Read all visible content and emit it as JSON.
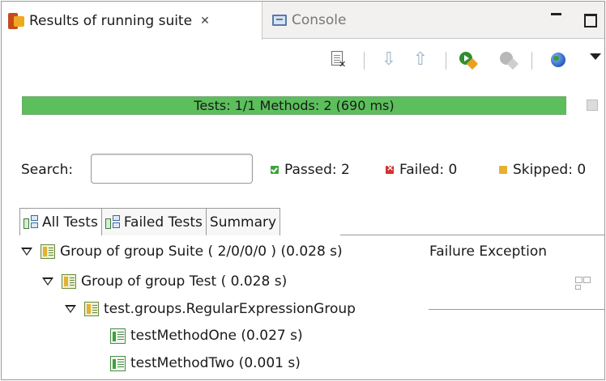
{
  "tabs": {
    "results_label": "Results of running suite",
    "console_label": "Console"
  },
  "progress": {
    "text": "Tests: 1/1  Methods: 2 (690 ms)",
    "fraction": 1.0,
    "color": "#5cbf5c"
  },
  "search": {
    "label": "Search:",
    "value": "",
    "placeholder": ""
  },
  "stats": {
    "passed": "Passed: 2",
    "failed": "Failed: 0",
    "skipped": "Skipped: 0"
  },
  "result_tabs": [
    "All Tests",
    "Failed Tests",
    "Summary"
  ],
  "failure_header": "Failure Exception",
  "tree": [
    {
      "label": "Group of group Suite ( 2/0/0/0 ) (0.028 s)",
      "type": "suite",
      "expanded": true
    },
    {
      "label": "Group of group Test ( 0.028 s)",
      "type": "suite",
      "expanded": true
    },
    {
      "label": "test.groups.RegularExpressionGroup",
      "type": "suite",
      "expanded": true
    },
    {
      "label": "testMethodOne  (0.027 s)",
      "type": "method"
    },
    {
      "label": "testMethodTwo  (0.001 s)",
      "type": "method"
    }
  ],
  "icons": {
    "results_tab": "testng-icon",
    "close": "close-icon",
    "console_tab": "console-icon",
    "minimize": "minimize-icon",
    "maximize": "maximize-icon",
    "clear": "clear-results-icon",
    "next_failure": "arrow-down-icon",
    "prev_failure": "arrow-up-icon",
    "rerun": "rerun-icon",
    "rerun_failed": "rerun-failed-icon",
    "web": "globe-icon",
    "view_menu": "chevron-down-icon",
    "stop": "stop-icon",
    "collapse_all": "collapse-all-icon"
  }
}
